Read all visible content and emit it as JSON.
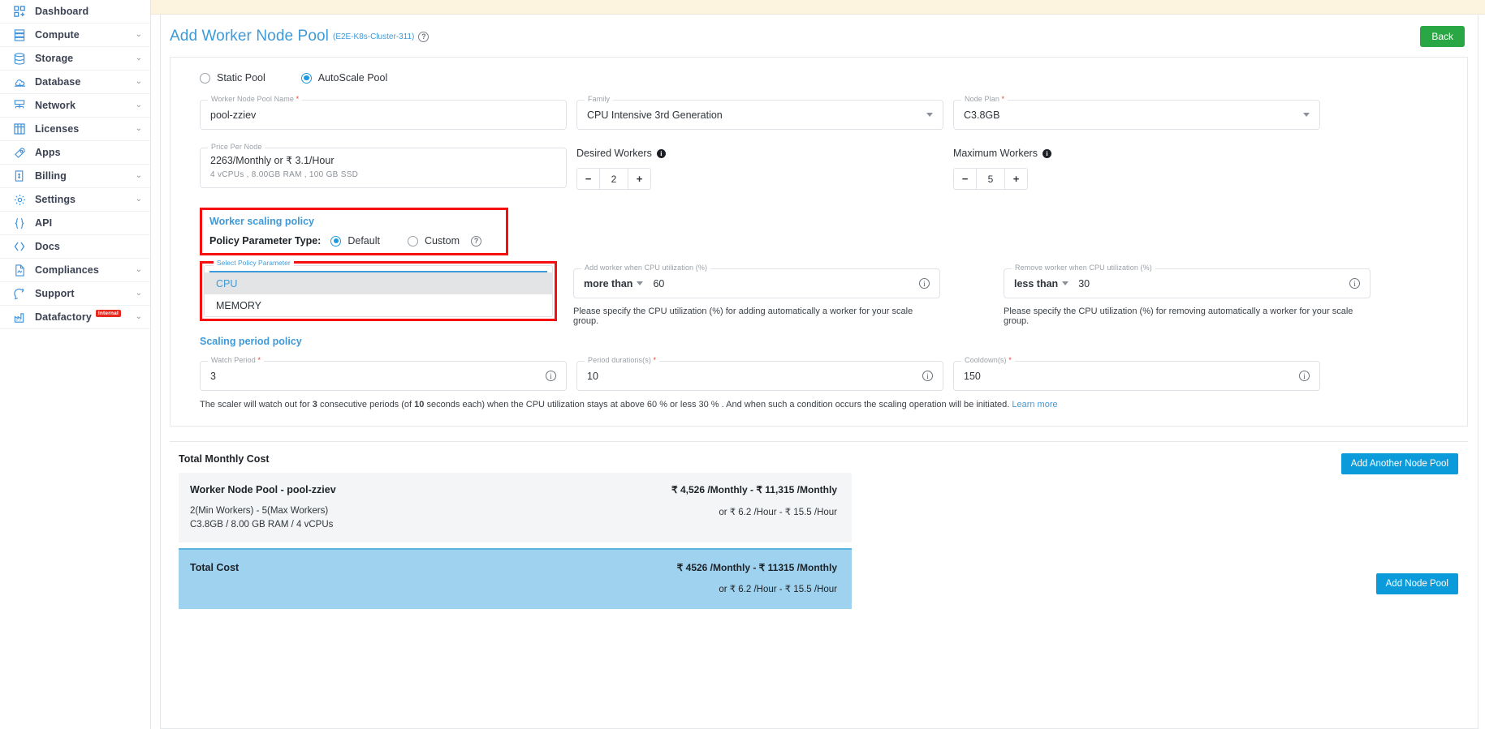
{
  "sidebar": {
    "items": [
      {
        "label": "Dashboard",
        "icon": "dashboard-icon",
        "chevron": false,
        "badge": null
      },
      {
        "label": "Compute",
        "icon": "server-icon",
        "chevron": true,
        "badge": null
      },
      {
        "label": "Storage",
        "icon": "database-stack-icon",
        "chevron": true,
        "badge": null
      },
      {
        "label": "Database",
        "icon": "cloud-database-icon",
        "chevron": true,
        "badge": null
      },
      {
        "label": "Network",
        "icon": "network-icon",
        "chevron": true,
        "badge": null
      },
      {
        "label": "Licenses",
        "icon": "license-grid-icon",
        "chevron": true,
        "badge": null
      },
      {
        "label": "Apps",
        "icon": "rocket-icon",
        "chevron": false,
        "badge": null
      },
      {
        "label": "Billing",
        "icon": "invoice-icon",
        "chevron": true,
        "badge": null
      },
      {
        "label": "Settings",
        "icon": "gear-icon",
        "chevron": true,
        "badge": null
      },
      {
        "label": "API",
        "icon": "braces-icon",
        "chevron": false,
        "badge": null
      },
      {
        "label": "Docs",
        "icon": "angle-brackets-icon",
        "chevron": false,
        "badge": null
      },
      {
        "label": "Compliances",
        "icon": "document-icon",
        "chevron": true,
        "badge": null
      },
      {
        "label": "Support",
        "icon": "support-icon",
        "chevron": true,
        "badge": null
      },
      {
        "label": "Datafactory",
        "icon": "factory-icon",
        "chevron": true,
        "badge": "Internal"
      }
    ]
  },
  "header": {
    "title": "Add Worker Node Pool",
    "cluster": "(E2E-K8s-Cluster-311)",
    "help_icon": "question-mark-icon",
    "back_label": "Back"
  },
  "pool_type": {
    "options": [
      {
        "label": "Static Pool",
        "selected": false
      },
      {
        "label": "AutoScale Pool",
        "selected": true
      }
    ]
  },
  "fields": {
    "pool_name": {
      "label": "Worker Node Pool Name",
      "required": true,
      "value": "pool-zziev"
    },
    "family": {
      "label": "Family",
      "required": false,
      "value": "CPU Intensive 3rd Generation"
    },
    "node_plan": {
      "label": "Node Plan",
      "required": true,
      "value": "C3.8GB"
    },
    "price_per_node": {
      "label": "Price Per Node",
      "value": "2263/Monthly or ₹ 3.1/Hour",
      "specs": "4  vCPUs ,   8.00GB RAM ,   100 GB SSD"
    },
    "desired_workers": {
      "label": "Desired Workers",
      "value": "2",
      "minus": "−",
      "plus": "+"
    },
    "maximum_workers": {
      "label": "Maximum Workers",
      "value": "5",
      "minus": "−",
      "plus": "+"
    }
  },
  "worker_scaling_policy": {
    "title": "Worker scaling policy",
    "param_type_label": "Policy Parameter Type:",
    "options": [
      {
        "label": "Default",
        "selected": true
      },
      {
        "label": "Custom",
        "selected": false
      }
    ],
    "help_icon": "question-mark-icon"
  },
  "policy_parameter": {
    "label": "Select Policy Parameter",
    "options": [
      {
        "label": "CPU",
        "selected": true
      },
      {
        "label": "MEMORY",
        "selected": false
      }
    ]
  },
  "add_worker": {
    "label": "Add worker when CPU utilization (%)",
    "operator": "more than",
    "value": "60",
    "helper": "Please specify the CPU utilization (%) for adding automatically a worker for your scale group."
  },
  "remove_worker": {
    "label": "Remove worker when CPU utilization (%)",
    "operator": "less than",
    "value": "30",
    "helper": "Please specify the CPU utilization (%) for removing automatically a worker for your scale group."
  },
  "scaling_period_policy": {
    "title": "Scaling period policy",
    "watch_period": {
      "label": "Watch Period",
      "required": true,
      "value": "3"
    },
    "period_duration": {
      "label": "Period durations(s)",
      "required": true,
      "value": "10"
    },
    "cooldown": {
      "label": "Cooldown(s)",
      "required": true,
      "value": "150"
    },
    "note_part1": "The scaler will watch out for ",
    "note_b1": "3",
    "note_part2": " consecutive periods (of ",
    "note_b2": "10",
    "note_part3": " seconds each) when the CPU utilization stays at above 60 % or less 30 % . And when such a condition occurs the scaling operation will be initiated. ",
    "note_link": "Learn more"
  },
  "cost": {
    "section_title": "Total Monthly Cost",
    "add_another_label": "Add Another Node Pool",
    "pool_row": {
      "name": "Worker Node Pool - pool-zziev",
      "workers": "2(Min Workers) - 5(Max Workers)",
      "specs": "C3.8GB / 8.00 GB RAM / 4 vCPUs",
      "monthly": "₹ 4,526 /Monthly - ₹ 11,315 /Monthly",
      "hourly": "or ₹ 6.2 /Hour - ₹ 15.5 /Hour"
    },
    "total_row": {
      "label": "Total Cost",
      "monthly": "₹ 4526 /Monthly - ₹ 11315 /Monthly",
      "hourly": "or ₹ 6.2 /Hour - ₹ 15.5 /Hour"
    },
    "add_node_pool_label": "Add Node Pool"
  },
  "colors": {
    "accent_blue": "#3f9ad8",
    "button_blue": "#0b9bdb",
    "green": "#2aa745",
    "highlight_red": "#f50f0f",
    "total_bg": "#9ed2ef"
  }
}
